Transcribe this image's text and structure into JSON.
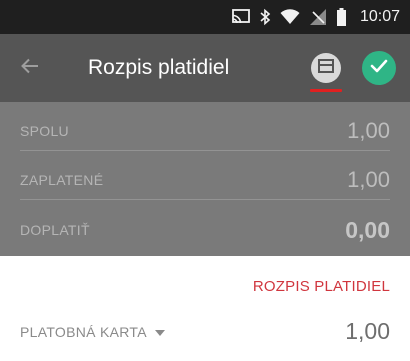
{
  "statusbar": {
    "time": "10:07",
    "icons": [
      "cast-icon",
      "bluetooth-icon",
      "wifi-icon",
      "signal-off-icon",
      "battery-icon"
    ]
  },
  "toolbar": {
    "title": "Rozpis platidiel",
    "back_icon": "arrow-left-icon",
    "receipt_icon": "receipt-icon",
    "confirm_icon": "check-icon"
  },
  "summary": {
    "total_label": "SPOLU",
    "total_value": "1,00",
    "paid_label": "ZAPLATENÉ",
    "paid_value": "1,00",
    "due_label": "DOPLATIŤ",
    "due_value": "0,00"
  },
  "payments": {
    "section_title": "ROZPIS PLATIDIEL",
    "items": [
      {
        "label": "PLATOBNÁ KARTA",
        "amount": "1,00"
      }
    ]
  },
  "colors": {
    "accent_red": "#d0363e",
    "confirm_green": "#2fb586",
    "toolbar_bg": "#555555"
  }
}
